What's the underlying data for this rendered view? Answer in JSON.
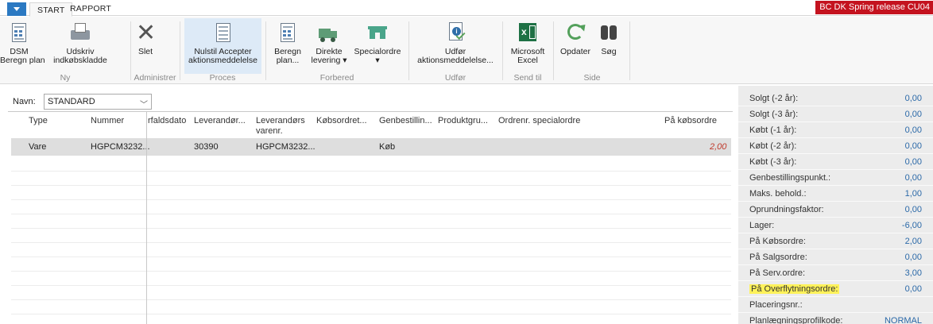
{
  "tabs": [
    {
      "label": "START",
      "active": true
    },
    {
      "label": "RAPPORT",
      "active": false
    }
  ],
  "release_badge": "BC DK Spring release CU04",
  "ribbon": {
    "buttons": {
      "dsm": "DSM\nBeregn plan",
      "udskriv": "Udskriv\nindkøbskladde",
      "slet": "Slet",
      "nulstil": "Nulstil Accepter\naktionsmeddelelse",
      "beregn": "Beregn\nplan...",
      "direkte": "Direkte\nlevering ▾",
      "special": "Specialordre\n▾",
      "udfor": "Udfør\naktionsmeddelelse...",
      "excel": "Microsoft\nExcel",
      "opdater": "Opdater",
      "sog": "Søg"
    },
    "groups": {
      "ny": "Ny",
      "administrer": "Administrer",
      "proces": "Proces",
      "forbered": "Forbered",
      "udfor": "Udfør",
      "sendtil": "Send til",
      "side": "Side"
    }
  },
  "name_filter": {
    "label": "Navn:",
    "value": "STANDARD"
  },
  "grid": {
    "columns": {
      "type": "Type",
      "nummer": "Nummer",
      "forfaldsdato": "rfaldsdato",
      "leverandor": "Leverandør...",
      "levvarenr": "Leverandørs\nvarenr.",
      "kobsordret": "Købsordret...",
      "genbestilling": "Genbestillin...",
      "produktgru": "Produktgru...",
      "ordrenr": "Ordrenr. specialordre",
      "paakobsordre": "På købsordre"
    },
    "rows": [
      {
        "type": "Vare",
        "nummer": "HGPCM3232...",
        "leverandor": "30390",
        "levvarenr": "HGPCM3232...",
        "genbestilling": "Køb",
        "paakobsordre": "2,00"
      }
    ]
  },
  "factbox": {
    "rows": [
      {
        "label": "Solgt (-2 år):",
        "value": "0,00"
      },
      {
        "label": "Solgt (-3 år):",
        "value": "0,00"
      },
      {
        "label": "Købt (-1 år):",
        "value": "0,00"
      },
      {
        "label": "Købt (-2 år):",
        "value": "0,00"
      },
      {
        "label": "Købt (-3 år):",
        "value": "0,00"
      },
      {
        "label": "Genbestillingspunkt.:",
        "value": "0,00"
      },
      {
        "label": "Maks. behold.:",
        "value": "1,00"
      },
      {
        "label": "Oprundningsfaktor:",
        "value": "0,00"
      },
      {
        "label": "Lager:",
        "value": "-6,00"
      },
      {
        "label": "På Købsordre:",
        "value": "2,00"
      },
      {
        "label": "På Salgsordre:",
        "value": "0,00"
      },
      {
        "label": "På Serv.ordre:",
        "value": "3,00"
      },
      {
        "label": "På Overflytningsordre:",
        "value": "0,00"
      },
      {
        "label": "Placeringsnr.:",
        "value": ""
      },
      {
        "label": "Planlægningsprofilkode:",
        "value": "NORMAL"
      }
    ]
  },
  "colors": {
    "accent": "#2b79c2",
    "release": "#c4131f",
    "negative_value": "#c0392b",
    "highlight": "#fff25a",
    "value_link": "#2b69a8"
  }
}
